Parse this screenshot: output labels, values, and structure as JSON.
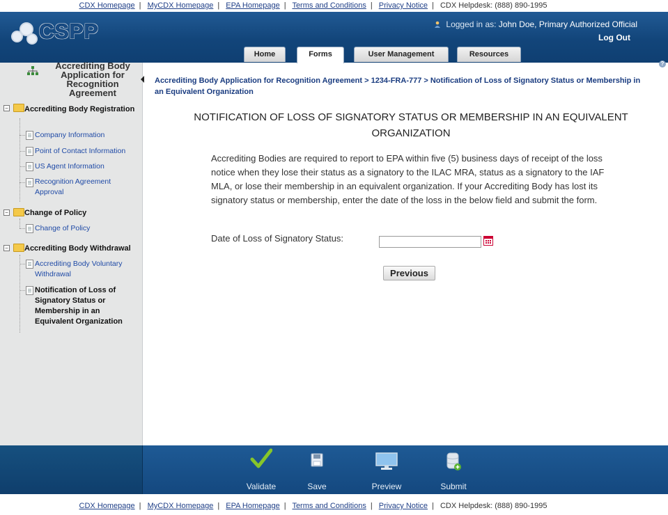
{
  "top_links": [
    "CDX Homepage",
    "MyCDX Homepage",
    "EPA Homepage",
    "Terms and Conditions",
    "Privacy Notice"
  ],
  "helpdesk": "CDX Helpdesk: (888) 890-1995",
  "header": {
    "logo_text": "CSPP",
    "logged_in_label": "Logged in as:",
    "user": "John Doe, Primary Authorized Official",
    "logout": "Log Out"
  },
  "tabs": [
    "Home",
    "Forms",
    "User Management",
    "Resources"
  ],
  "active_tab": "Forms",
  "sidebar": {
    "title": "Accrediting Body Application for Recognition Agreement",
    "groups": [
      {
        "label": "Accrediting Body Registration",
        "items": [
          "Company Information",
          "Point of Contact Information",
          "US Agent Information",
          "Recognition Agreement Approval"
        ]
      },
      {
        "label": "Change of Policy",
        "items": [
          "Change of Policy"
        ]
      },
      {
        "label": "Accrediting Body Withdrawal",
        "items": [
          "Accrediting Body Voluntary Withdrawal",
          "Notification of Loss of Signatory Status or Membership in an Equivalent Organization"
        ]
      }
    ]
  },
  "breadcrumb": "Accrediting Body Application for Recognition Agreement > 1234-FRA-777 > Notification of Loss of Signatory Status or Membership in an Equivalent Organization",
  "main": {
    "title": "NOTIFICATION OF LOSS OF SIGNATORY STATUS OR MEMBERSHIP IN AN EQUIVALENT ORGANIZATION",
    "paragraph": "Accrediting Bodies are required to report to EPA within five (5) business days of receipt of the loss notice when they lose their status as a signatory to the ILAC MRA, status as a signatory to the IAF MLA, or lose their membership in an equivalent organization. If your Accrediting Body has lost its signatory status or membership, enter the date of the loss in the below field and submit the form.",
    "date_label": "Date of Loss of Signatory Status:",
    "date_value": "",
    "previous_button": "Previous"
  },
  "footer_actions": [
    {
      "label": "Validate",
      "icon": "checkmark-icon"
    },
    {
      "label": "Save",
      "icon": "floppy-disk-icon"
    },
    {
      "label": "Preview",
      "icon": "monitor-icon"
    },
    {
      "label": "Submit",
      "icon": "database-submit-icon"
    }
  ],
  "colors": {
    "header_blue": "#12457a",
    "link_blue": "#1f4aa6",
    "sidebar_bg": "#e5e6e6",
    "validate_green": "#7fc41c"
  }
}
